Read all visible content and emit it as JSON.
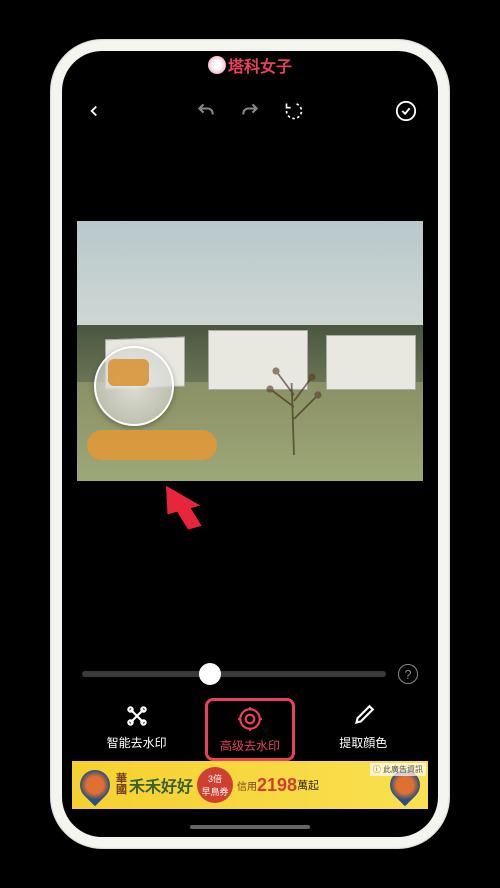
{
  "watermark": {
    "text": "塔科女子"
  },
  "toolbar": {
    "back": "back",
    "undo": "undo",
    "redo": "redo",
    "reset": "reset",
    "confirm": "confirm"
  },
  "slider": {
    "value": 42,
    "help": "?"
  },
  "tools": {
    "smart": {
      "label": "智能去水印"
    },
    "advanced": {
      "label": "高级去水印"
    },
    "color": {
      "label": "提取顔色"
    }
  },
  "ad": {
    "brand_line1": "華",
    "brand_line2": "國",
    "slogan": "禾禾好好",
    "badge_line1": "3倍",
    "badge_line2": "早鳥券",
    "extra": "信用",
    "price": "2198",
    "suffix": "萬起",
    "info": "ⓘ 此廣告資訊"
  },
  "colors": {
    "accent": "#e8415a",
    "ad_bg": "#f5d030"
  }
}
